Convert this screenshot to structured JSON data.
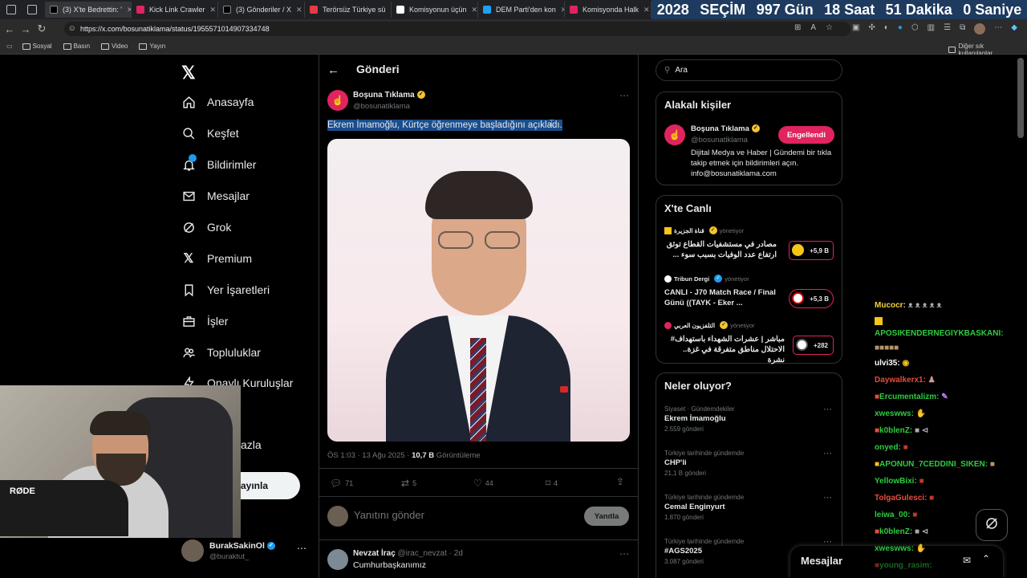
{
  "browser": {
    "tabs": [
      {
        "label": "(3) X'te Bedrettin: '",
        "color": "#e7e9ea"
      },
      {
        "label": "Kick Link Crawler",
        "color": "#e0245e"
      },
      {
        "label": "(3) Gönderiler / X",
        "color": "#e7e9ea"
      },
      {
        "label": "Terörsüz Türkiye sü",
        "color": "#e63946"
      },
      {
        "label": "Komisyonun üçün",
        "color": "#ffffff"
      },
      {
        "label": "DEM Parti'den kon",
        "color": "#1da1f2"
      },
      {
        "label": "Komisyonda Halk",
        "color": "#e0245e"
      }
    ],
    "countdown": {
      "year": "2028",
      "event": "SEÇİM",
      "days": "997 Gün",
      "hours": "18 Saat",
      "minutes": "51 Dakika",
      "seconds": "0 Saniye"
    },
    "url": "https://x.com/bosunatiklama/status/1955571014907334748",
    "bookmarks": [
      "Sosyal",
      "Basın",
      "Video",
      "Yayın"
    ],
    "other_bookmarks": "Diğer sık kullanılanlar"
  },
  "nav": {
    "items": [
      {
        "label": "Anasayfa",
        "icon": "home-icon"
      },
      {
        "label": "Keşfet",
        "icon": "search-icon"
      },
      {
        "label": "Bildirimler",
        "icon": "bell-icon"
      },
      {
        "label": "Mesajlar",
        "icon": "mail-icon"
      },
      {
        "label": "Grok",
        "icon": "grok-icon"
      },
      {
        "label": "Premium",
        "icon": "x-icon"
      },
      {
        "label": "Yer İşaretleri",
        "icon": "bookmark-icon"
      },
      {
        "label": "İşler",
        "icon": "briefcase-icon"
      },
      {
        "label": "Topluluklar",
        "icon": "people-icon"
      },
      {
        "label": "Onaylı Kuruluşlar",
        "icon": "bolt-icon"
      }
    ],
    "more_partial": "azla",
    "post_partial": "ayınla",
    "account_name": "BurakSakinOl",
    "account_handle": "@buraktut_"
  },
  "post": {
    "header_title": "Gönderi",
    "author_name": "Boşuna Tıklama",
    "author_handle": "@bosunatiklama",
    "text": "Ekrem İmamoğlu, Kürtçe öğrenmeye başladığını açıkladı.",
    "time": "ÖS 1:03 · 13 Ağu 2025 ·",
    "views_count": "10,7 B",
    "views_label": "Görüntüleme",
    "replies": "71",
    "retweets": "5",
    "likes": "44",
    "bookmarks": "4",
    "reply_placeholder": "Yanıtını gönder",
    "reply_button": "Yanıtla"
  },
  "reply": {
    "name": "Nevzat İraç",
    "handle": "@irac_nevzat",
    "age": "· 2d",
    "text": "Cumhurbaşkanımız"
  },
  "right": {
    "search_placeholder": "Ara",
    "related_title": "Alakalı kişiler",
    "related": {
      "name": "Boşuna Tıklama",
      "handle": "@bosunatiklama",
      "button": "Engellendi",
      "bio": "Dijital Medya ve Haber | Gündemi bir tıkla takip etmek için bildirimleri açın. info@bosunatiklama.com"
    },
    "live_title": "X'te Canlı",
    "live": [
      {
        "host": "قناة الجزيرة",
        "status": "yönetiyor",
        "title": "مصادر في مستشفيات القطاع توثق ارتفاع عدد الوفيات بسبب سوء ...",
        "count": "+5,9 B"
      },
      {
        "host": "Tribun Dergi",
        "status": "yönetiyor",
        "title": "CANLI - J70 Match Race / Final Günü ((TAYK - Eker ...",
        "count": "+5,3 B"
      },
      {
        "host": "التلفزيون العربي",
        "status": "yönetiyor",
        "title": "مباشر | عشرات الشهداء باستهداف# الاحتلال مناطق متفرقة في غزة.. نشرة",
        "count": "+282"
      }
    ],
    "trends_title": "Neler oluyor?",
    "trends": [
      {
        "context": "Siyaset · Gündemdekiler",
        "name": "Ekrem İmamoğlu",
        "posts": "2.559 gönderi"
      },
      {
        "context": "Türkiye tarihinde gündemde",
        "name": "CHP'li",
        "posts": "21,1 B gönderi"
      },
      {
        "context": "Türkiye tarihinde gündemde",
        "name": "Cemal Enginyurt",
        "posts": "1.870 gönderi"
      },
      {
        "context": "Türkiye tarihinde gündemde",
        "name": "#AGS2025",
        "posts": "3.087 gönderi"
      }
    ],
    "messages_label": "Mesajlar"
  },
  "chat": [
    {
      "user": "Mucocr:",
      "msg": "",
      "color": "#f4d03f"
    },
    {
      "user": "APOSIKENDERNEGIYKBASKANI:",
      "msg": "",
      "color": "#2ecc40"
    },
    {
      "user": "ulvi35:",
      "msg": "",
      "color": "#ffffff"
    },
    {
      "user": "Daywalkerx1:",
      "msg": "",
      "color": "#e74c3c"
    },
    {
      "user": "Ercumentalizm:",
      "msg": "",
      "color": "#2ecc40"
    },
    {
      "user": "xweswws:",
      "msg": "",
      "color": "#2ecc40"
    },
    {
      "user": "k0blenZ:",
      "msg": "",
      "color": "#2ecc40"
    },
    {
      "user": "onyed:",
      "msg": "",
      "color": "#2ecc40"
    },
    {
      "user": "APONUN_7CEDDINI_SIKEN:",
      "msg": "",
      "color": "#2ecc40"
    },
    {
      "user": "YellowBixi:",
      "msg": "",
      "color": "#2ecc40"
    },
    {
      "user": "TolgaGulesci:",
      "msg": "",
      "color": "#e74c3c"
    },
    {
      "user": "leiwa_00:",
      "msg": "",
      "color": "#2ecc40"
    },
    {
      "user": "k0blenZ:",
      "msg": "",
      "color": "#2ecc40"
    },
    {
      "user": "xweswws:",
      "msg": "",
      "color": "#2ecc40"
    },
    {
      "user": "young_rasim:",
      "msg": "",
      "color": "#2ecc40"
    }
  ],
  "webcam": {
    "mic_brand": "RØDE"
  }
}
